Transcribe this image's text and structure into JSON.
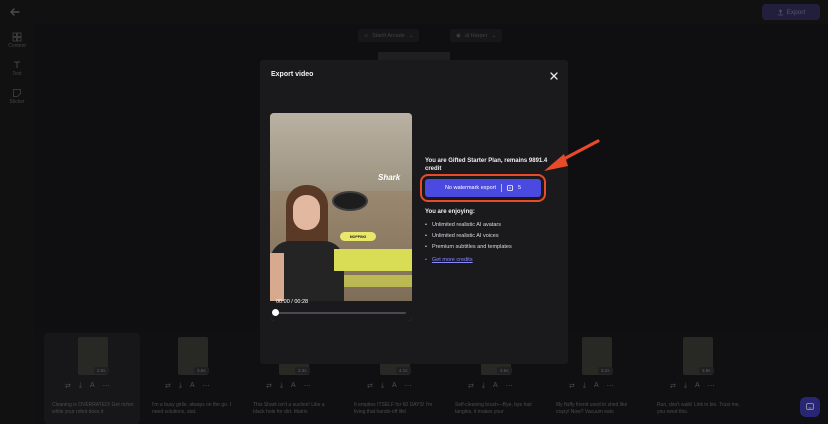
{
  "app": {
    "export_label": "Export",
    "rail": [
      {
        "label": "Content",
        "icon": "grid-icon"
      },
      {
        "label": "Text",
        "icon": "text-icon"
      },
      {
        "label": "Sticker",
        "icon": "sticker-icon"
      }
    ],
    "toolbar": {
      "music_label": "Starlit Arcade",
      "voice_label": "al Harper"
    }
  },
  "timeline": {
    "clips": [
      {
        "duration": "2.5s",
        "caption": "Cleaning is OVERRATED! Get richer while your robot does it"
      },
      {
        "duration": "3.6s",
        "caption": "I'm a busy girlie, always on the go. I need solutions, stat."
      },
      {
        "duration": "3.3s",
        "caption": "This Shark isn't a suction! Like a black hole for dirt. Matrix"
      },
      {
        "duration": "4.1s",
        "caption": "It empties ITSELF for 60 DAYS! I'm living that hands-off life!"
      },
      {
        "duration": "3.5s",
        "caption": "Self-cleaning brush—Bye, bye hair tangles, it makes your"
      },
      {
        "duration": "3.2s",
        "caption": "My fluffy friend used to shed like crazy! Now? Vacuum eats"
      },
      {
        "duration": "3.8s",
        "caption": "Run, don't walk! Link in bio. Trust me, you need this."
      }
    ]
  },
  "modal": {
    "title": "Export video",
    "time": "00:00 / 00:28",
    "brand_text": "Shark",
    "mop_tag": "MOPPING",
    "plan_text": "You are Gifted Starter Plan, remains 9891.4 credit",
    "button_label": "No watermark export",
    "button_cost": "5",
    "enjoying_label": "You are enjoying:",
    "benefits": [
      "Unlimited realistic AI avatars",
      "Unlimited realistic AI voices",
      "Premium subtitles and templates"
    ],
    "more_credits": "Get more credits"
  },
  "colors": {
    "accent": "#4b4ae0",
    "highlight": "#e84b2a"
  }
}
